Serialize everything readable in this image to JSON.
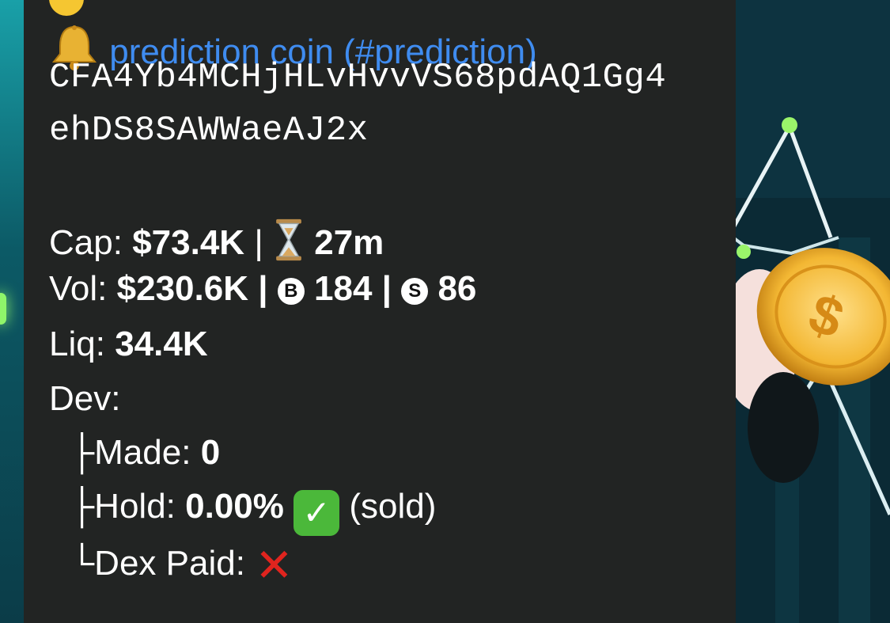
{
  "message": {
    "coin_link": "prediction coin (#prediction)",
    "contract_line1": "CFA4Yb4MCHjHLvHvvVS68pdAQ1Gg4",
    "contract_line2": "ehDS8SAWWaeAJ2x",
    "cap_label": "Cap:",
    "cap_value": "$73.4K",
    "separator": "|",
    "age_value": "27m",
    "vol_label": "Vol:",
    "vol_value": "$230.6K",
    "buys_badge": "B",
    "buys_value": "184",
    "sells_badge": "S",
    "sells_value": "86",
    "liq_label": "Liq:",
    "liq_value": "34.4K",
    "dev_label": "Dev:",
    "made_prefix": "├Made:",
    "made_value": "0",
    "hold_prefix": "├Hold:",
    "hold_value": "0.00%",
    "hold_note": "(sold)",
    "dex_prefix": "└Dex Paid:"
  },
  "icons": {
    "bell": "bell-icon",
    "hourglass": "hourglass-icon",
    "buy_badge": "buy-badge-icon",
    "sell_badge": "sell-badge-icon",
    "check": "check-mark-icon",
    "cross": "cross-mark-icon"
  },
  "colors": {
    "bubble": "#222423",
    "link": "#3f8cf0",
    "check": "#4bb83a",
    "cross": "#e0241e"
  }
}
